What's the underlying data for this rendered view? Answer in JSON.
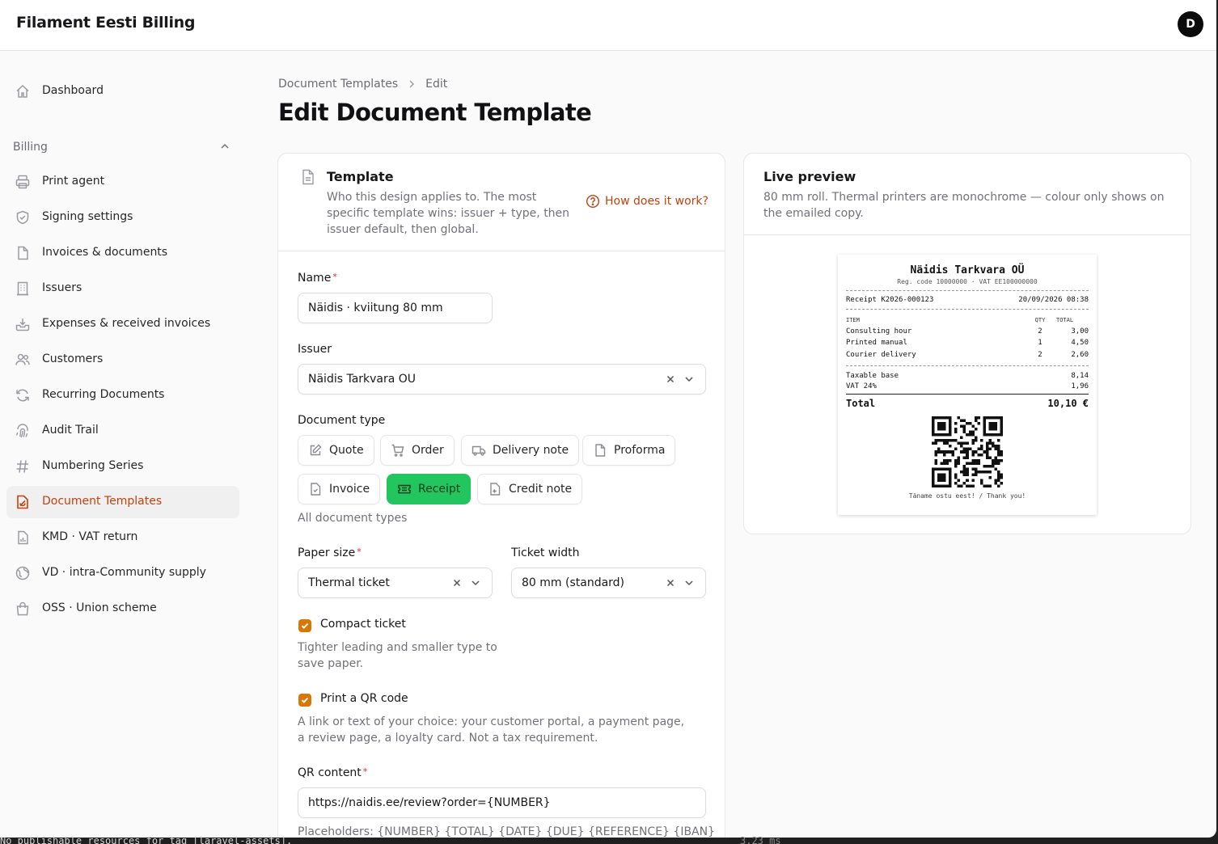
{
  "app": {
    "brand": "Filament Eesti Billing",
    "avatar_initial": "D"
  },
  "sidebar": {
    "dashboard": "Dashboard",
    "group_label": "Billing",
    "items": [
      {
        "label": "Print agent",
        "icon": "printer-icon"
      },
      {
        "label": "Signing settings",
        "icon": "shield-check-icon"
      },
      {
        "label": "Invoices & documents",
        "icon": "document-icon"
      },
      {
        "label": "Issuers",
        "icon": "building-icon"
      },
      {
        "label": "Expenses & received invoices",
        "icon": "inbox-download-icon"
      },
      {
        "label": "Customers",
        "icon": "users-icon"
      },
      {
        "label": "Recurring Documents",
        "icon": "refresh-icon"
      },
      {
        "label": "Audit Trail",
        "icon": "fingerprint-icon"
      },
      {
        "label": "Numbering Series",
        "icon": "hashtag-icon"
      },
      {
        "label": "Document Templates",
        "icon": "template-icon",
        "active": true
      },
      {
        "label": "KMD · VAT return",
        "icon": "document-chart-icon"
      },
      {
        "label": "VD · intra-Community supply",
        "icon": "globe-icon"
      },
      {
        "label": "OSS · Union scheme",
        "icon": "shopping-bag-icon"
      }
    ]
  },
  "breadcrumb": {
    "parent": "Document Templates",
    "current": "Edit"
  },
  "page": {
    "title": "Edit Document Template"
  },
  "template_section": {
    "title": "Template",
    "description": "Who this design applies to. The most specific template wins: issuer + type, then issuer default, then global.",
    "help_link": "How does it work?"
  },
  "form": {
    "name_label": "Name",
    "name_value": "Näidis · kviitung 80 mm",
    "issuer_label": "Issuer",
    "issuer_value": "Näidis Tarkvara OÜ",
    "doc_type_label": "Document type",
    "doc_types": [
      {
        "label": "Quote"
      },
      {
        "label": "Order"
      },
      {
        "label": "Delivery note"
      },
      {
        "label": "Proforma"
      },
      {
        "label": "Invoice"
      },
      {
        "label": "Receipt",
        "selected": true
      },
      {
        "label": "Credit note"
      }
    ],
    "doc_type_hint": "All document types",
    "paper_size_label": "Paper size",
    "paper_size_value": "Thermal ticket",
    "ticket_width_label": "Ticket width",
    "ticket_width_value": "80 mm (standard)",
    "compact_label": "Compact ticket",
    "compact_hint": "Tighter leading and smaller type to save paper.",
    "qr_label": "Print a QR code",
    "qr_hint": "A link or text of your choice: your customer portal, a payment page, a review page, a loyalty card. Not a tax requirement.",
    "qr_content_label": "QR content",
    "qr_content_value": "https://naidis.ee/review?order={NUMBER}",
    "placeholders_hint": "Placeholders: {NUMBER} {TOTAL} {DATE} {DUE} {REFERENCE} {IBAN}"
  },
  "preview": {
    "title": "Live preview",
    "description": "80 mm roll. Thermal printers are monochrome — colour only shows on the emailed copy."
  },
  "receipt": {
    "company": "Näidis Tarkvara OÜ",
    "reg_line": "Reg. code 10000000 · VAT EE100000000",
    "number": "Receipt K2026-000123",
    "datetime": "20/09/2026 08:38",
    "col_item": "ITEM",
    "col_qty": "QTY",
    "col_total": "TOTAL",
    "lines": [
      {
        "item": "Consulting hour",
        "qty": "2",
        "total": "3,00"
      },
      {
        "item": "Printed manual",
        "qty": "1",
        "total": "4,50"
      },
      {
        "item": "Courier delivery",
        "qty": "2",
        "total": "2,60"
      }
    ],
    "taxable_label": "Taxable base",
    "taxable_value": "8,14",
    "vat_label": "VAT 24%",
    "vat_value": "1,96",
    "total_label": "Total",
    "total_value": "10,10 €",
    "thanks": "Täname ostu eest! / Thank you!"
  },
  "terminal": {
    "left": "No publishable resources for tag [laravel-assets].",
    "right": "3.23 ms"
  },
  "colors": {
    "accent": "#c2410c",
    "checkbox": "#d97706",
    "selected_chip": "#22c55e"
  }
}
